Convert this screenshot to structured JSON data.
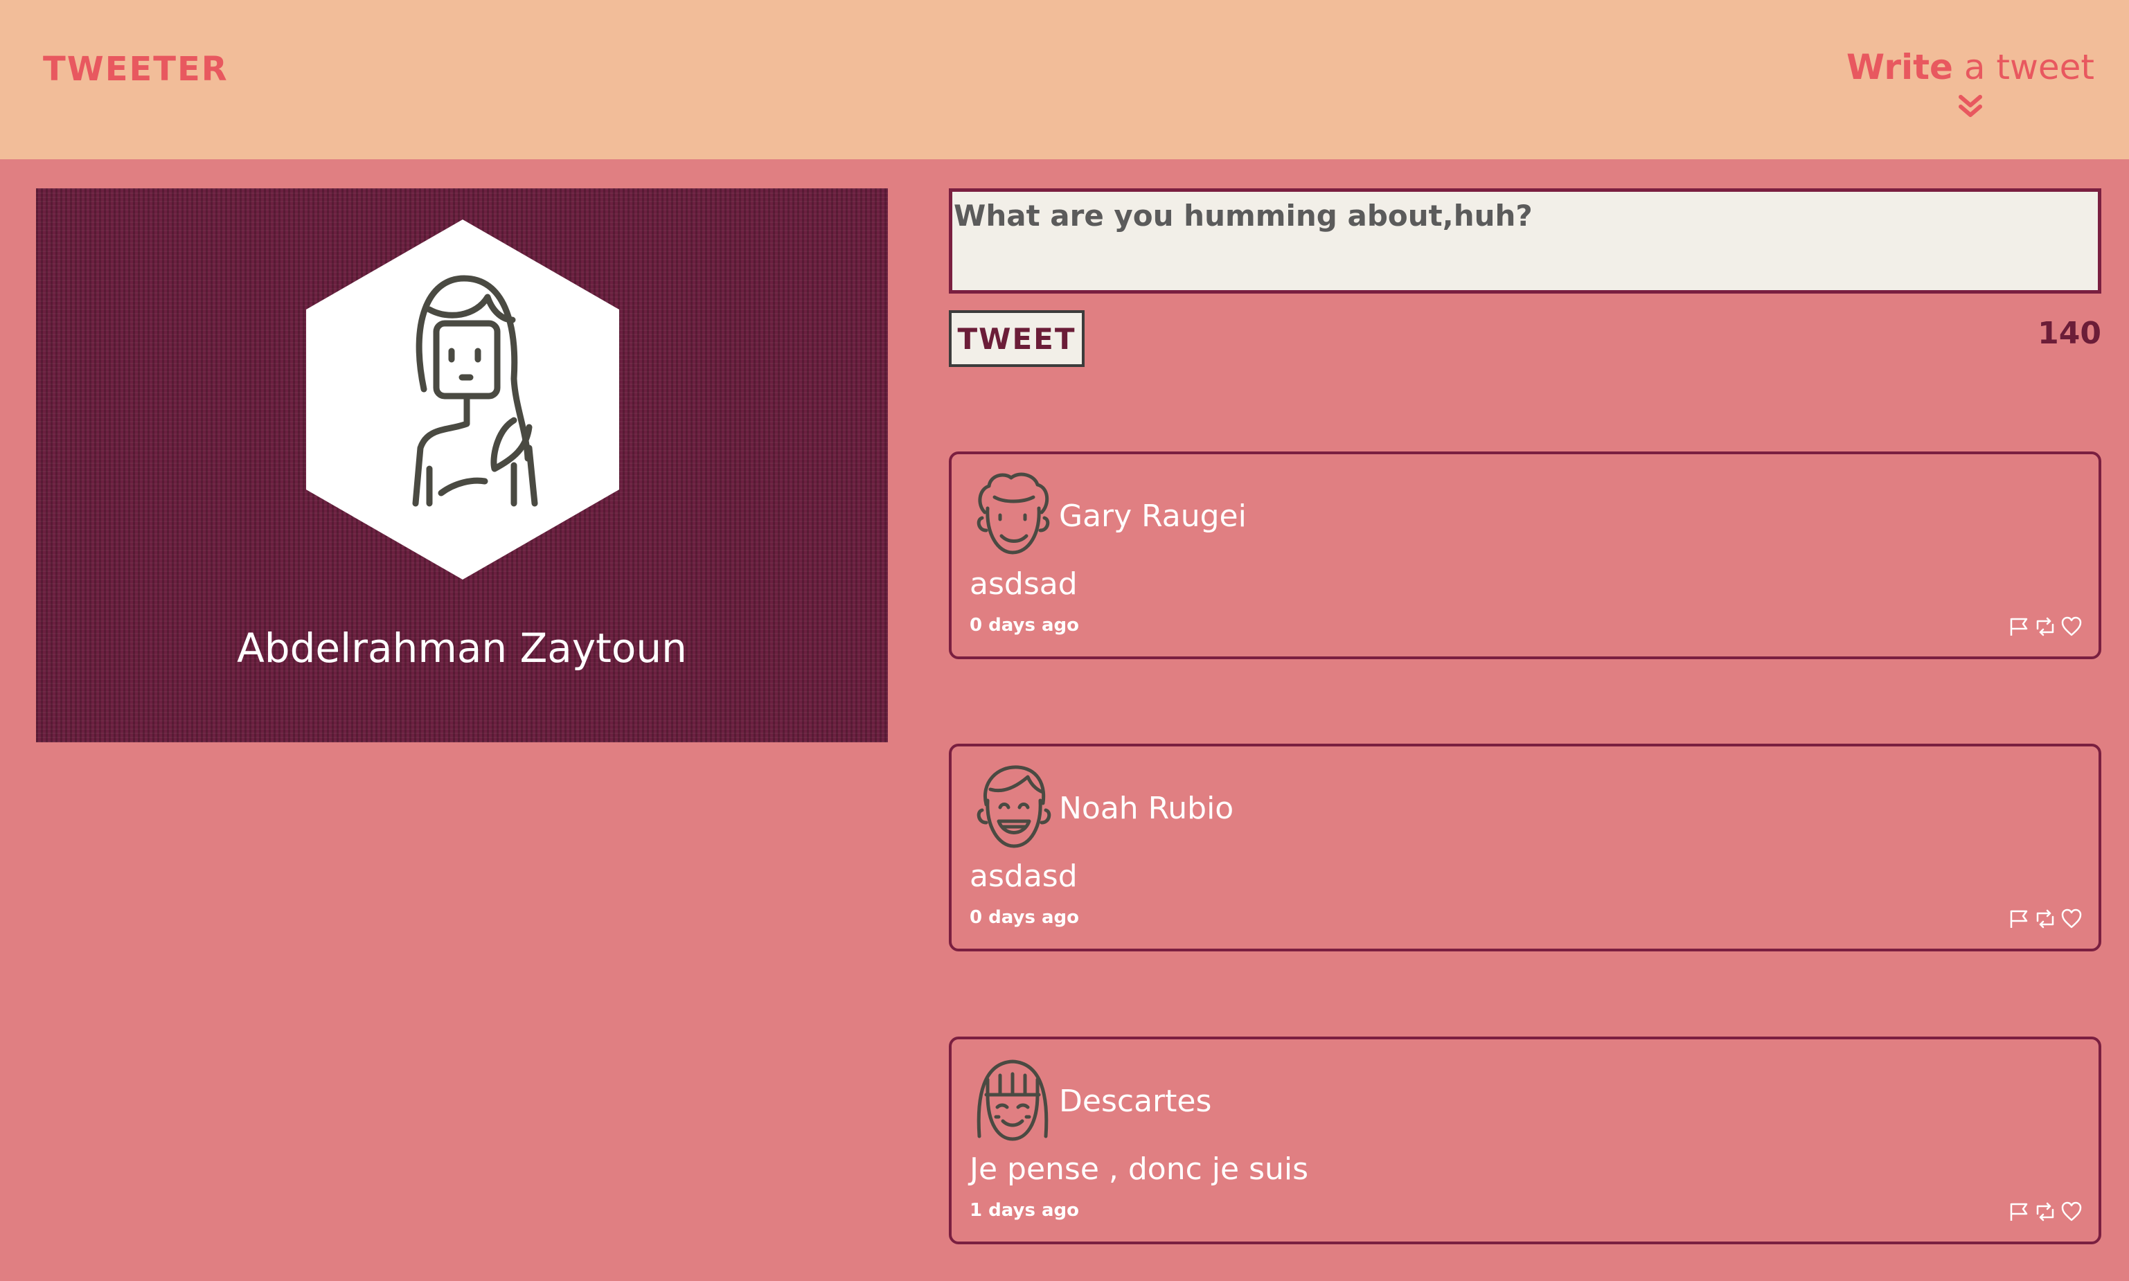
{
  "header": {
    "brand": "TWEETER",
    "compose_bold": "Write",
    "compose_rest": " a tweet"
  },
  "profile": {
    "name": "Abdelrahman Zaytoun"
  },
  "composer": {
    "placeholder": "What are you humming about,huh?",
    "button_label": "TWEET",
    "counter": "140"
  },
  "tweets": [
    {
      "user": "Gary Raugei",
      "text": "asdsad",
      "time": "0 days ago"
    },
    {
      "user": "Noah Rubio",
      "text": "asdasd",
      "time": "0 days ago"
    },
    {
      "user": "Descartes",
      "text": "Je pense , donc je suis",
      "time": "1 days ago"
    }
  ],
  "icons": {
    "compose": "chevron-double-down-icon",
    "flag": "flag-icon",
    "retweet": "retweet-icon",
    "like": "heart-icon"
  },
  "colors": {
    "background": "#e07f82",
    "navbar": "#f2bd99",
    "brand": "#e8585f",
    "accent": "#7a1f40"
  }
}
